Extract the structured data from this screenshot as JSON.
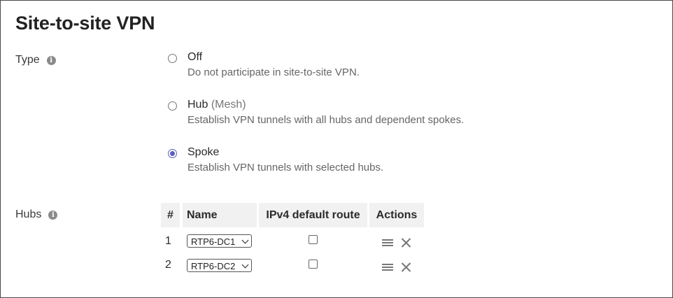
{
  "page": {
    "title": "Site-to-site VPN"
  },
  "type_field": {
    "label": "Type",
    "info_icon": "info-icon",
    "options": [
      {
        "label": "Off",
        "sub": "",
        "description": "Do not participate in site-to-site VPN.",
        "checked": false
      },
      {
        "label": "Hub",
        "sub": "(Mesh)",
        "description": "Establish VPN tunnels with all hubs and dependent spokes.",
        "checked": false
      },
      {
        "label": "Spoke",
        "sub": "",
        "description": "Establish VPN tunnels with selected hubs.",
        "checked": true
      }
    ]
  },
  "hubs_field": {
    "label": "Hubs",
    "info_icon": "info-icon",
    "columns": [
      "#",
      "Name",
      "IPv4 default route",
      "Actions"
    ],
    "rows": [
      {
        "num": "1",
        "name": "RTP6-DC1",
        "ipv4_default_route": false
      },
      {
        "num": "2",
        "name": "RTP6-DC2",
        "ipv4_default_route": false
      }
    ],
    "row_action_icons": [
      "reorder-icon",
      "close-icon"
    ]
  },
  "colors": {
    "radio_accent": "#5a5fc0",
    "header_bg": "#f1f1f1"
  }
}
